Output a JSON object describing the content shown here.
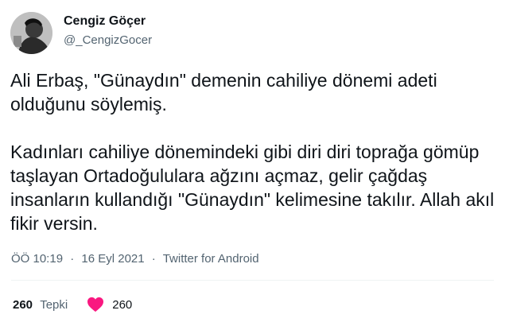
{
  "author": {
    "name": "Cengiz Göçer",
    "handle": "@_CengizGocer"
  },
  "tweet": {
    "paragraph1": "Ali Erbaş, \"Günaydın\" demenin cahiliye dönemi adeti olduğunu söylemiş.",
    "paragraph2": "Kadınları cahiliye dönemindeki gibi diri diri toprağa gömüp taşlayan Ortadoğululara ağzını açmaz, gelir çağdaş insanların kullandığı \"Günaydın\" kelimesine takılır. Allah akıl fikir versin.",
    "time": "ÖÖ 10:19",
    "date": "16 Eyl 2021",
    "separator": "·",
    "source": "Twitter for Android"
  },
  "stats": {
    "reactions_count": "260",
    "reactions_label": "Tepki",
    "likes_count": "260",
    "heart_icon": "heart-icon",
    "heart_color": "#f91880"
  }
}
